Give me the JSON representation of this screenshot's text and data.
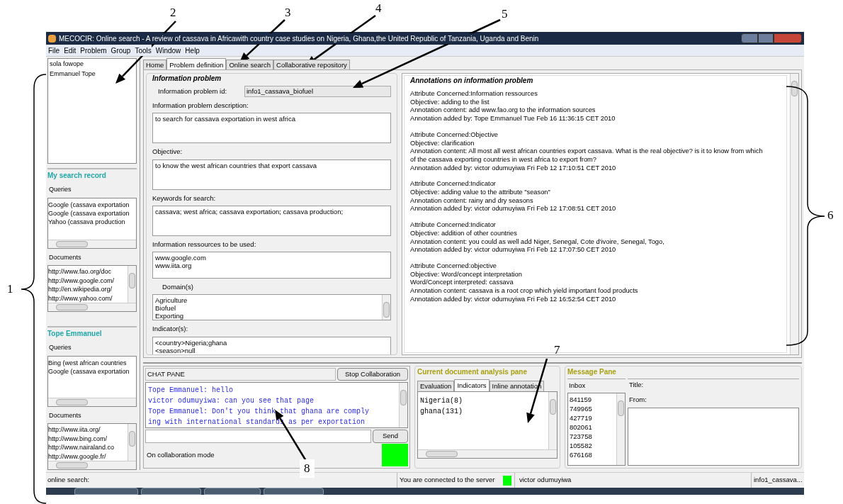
{
  "window": {
    "title": "MECOCIR: Online search - A review of cassava in Africawith country case studies on Nigeria, Ghana,the United Republic of Tanzania, Uganda and Benin"
  },
  "menu": [
    "File",
    "Edit",
    "Problem",
    "Group",
    "Tools",
    "Window",
    "Help"
  ],
  "users": [
    "sola fowope",
    "Emmanuel Tope"
  ],
  "search_records": [
    {
      "title": "My search record",
      "queries_label": "Queries",
      "queries": [
        "Google (cassava exportation",
        "Google (cassava exportation",
        "Yahoo (cassava production"
      ],
      "documents_label": "Documents",
      "documents": [
        "http://www.fao.org/doc",
        "http://www.google.com/",
        "http://en.wikipedia.org/",
        "http://www.yahoo.com/"
      ]
    },
    {
      "title": "Tope Emmanuel",
      "queries_label": "Queries",
      "queries": [
        "Bing (west african countries",
        "Google (cassava exportation"
      ],
      "documents_label": "Documents",
      "documents": [
        "http://www.iita.org/",
        "http://www.bing.com/",
        "http://www.nairaland.co",
        "http://www.google.fr/"
      ]
    }
  ],
  "tabs": [
    {
      "label": "Home",
      "selected": false
    },
    {
      "label": "Problem definition",
      "selected": true
    },
    {
      "label": "Online search",
      "selected": false
    },
    {
      "label": "Collaborative repository",
      "selected": false
    }
  ],
  "information_problem": {
    "title": "Information problem",
    "id_label": "Information problem id:",
    "id_value": "info1_cassava_biofuel",
    "fields": [
      {
        "label": "Information problem description:",
        "kind": "text",
        "lines": [
          "to search for cassava exportation in west africa"
        ]
      },
      {
        "label": "Objective:",
        "kind": "text",
        "lines": [
          "to know the west african countries that export cassava"
        ]
      },
      {
        "label": "Keywords for search:",
        "kind": "text",
        "lines": [
          "cassava; west africa; cassava exportation; cassava production;"
        ]
      },
      {
        "label": "Information ressources to be used:",
        "kind": "text",
        "lines": [
          "www.google.com",
          "www.iita.org"
        ]
      },
      {
        "label": "Domain(s)",
        "kind": "list",
        "lines": [
          "Agriculture",
          "Biofuel",
          "Exporting"
        ]
      },
      {
        "label": "Indicator(s):",
        "kind": "text",
        "lines": [
          "<country>Nigeria;ghana",
          "<season>null"
        ]
      }
    ]
  },
  "annotations": {
    "title": "Annotations on information problem",
    "entries": [
      {
        "lines": [
          "Attribute Concerned:Information ressources",
          "Objective: adding to the list",
          "Annotation content: add www.fao.org to the information sources",
          "Annotation added by: Tope Emmanuel  Tue Feb 16 11:36:15 CET 2010"
        ]
      },
      {
        "lines": [
          "Attribute Concerned:Objective",
          "Objective: clarification",
          "Annotation content: All most all west african countries export cassava. What is the real objective? is it to know from which of the cassava exporting countries in west africa to export from?",
          "Annotation added by: victor odumuyiwa  Fri Feb 12 17:10:51 CET 2010"
        ]
      },
      {
        "lines": [
          "Attribute Concerned:Indicator",
          "Objective: adding value to the attribute \"season\"",
          "Annotation content: rainy and dry seasons",
          "Annotation added by: victor odumuyiwa  Fri Feb 12 17:08:51 CET 2010"
        ]
      },
      {
        "lines": [
          "Attribute Concerned:Indicator",
          "Objective: addition of other countries",
          "Annotation content: you could as well add Niger, Senegal, Cote d'ivoire, Senegal, Togo,",
          "Annotation added by: victor odumuyiwa  Fri Feb 12 17:07:50 CET 2010"
        ]
      },
      {
        "lines": [
          "Attribute Concerned:objective",
          "Objective: Word/concept interpretation",
          "Word/Concept interpreted: cassava",
          "Annotation content: cassava is a root crop which yield important food products",
          "Annotation added by: victor odumuyiwa  Fri Feb 12 16:52:54 CET 2010"
        ]
      }
    ]
  },
  "chat": {
    "title": "CHAT PANE",
    "stop_button": "Stop Collaboration",
    "lines": [
      "Tope Emmanuel: hello",
      "victor odumuyiwa: can you see that page",
      "Tope Emmanuel: Don't you think that ghana are comply",
      "ing with international standards as per exportation"
    ],
    "send_button": "Send",
    "mode": "On collaboration mode",
    "collaborating": true
  },
  "document_analysis": {
    "title": "Current document analysis pane",
    "tabs": [
      {
        "label": "Evaluation",
        "selected": false
      },
      {
        "label": "Indicators",
        "selected": true
      },
      {
        "label": "Inline annotation",
        "selected": false
      }
    ],
    "lines": [
      "Nigeria(8)",
      "ghana(131)"
    ]
  },
  "message_pane": {
    "title": "Message Pane",
    "inbox_label": "Inbox",
    "inbox": [
      "841159",
      "749965",
      "427719",
      "802061",
      "723758",
      "105582",
      "676168"
    ],
    "title_label": "Title:",
    "from_label": "From:"
  },
  "status_bar": {
    "left": "online search:",
    "connection": "You are connected to the server",
    "connected": true,
    "user": "victor odumuyiwa",
    "problem": "info1_cassava..."
  },
  "callouts": [
    "1",
    "2",
    "3",
    "4",
    "5",
    "6",
    "7",
    "8"
  ]
}
